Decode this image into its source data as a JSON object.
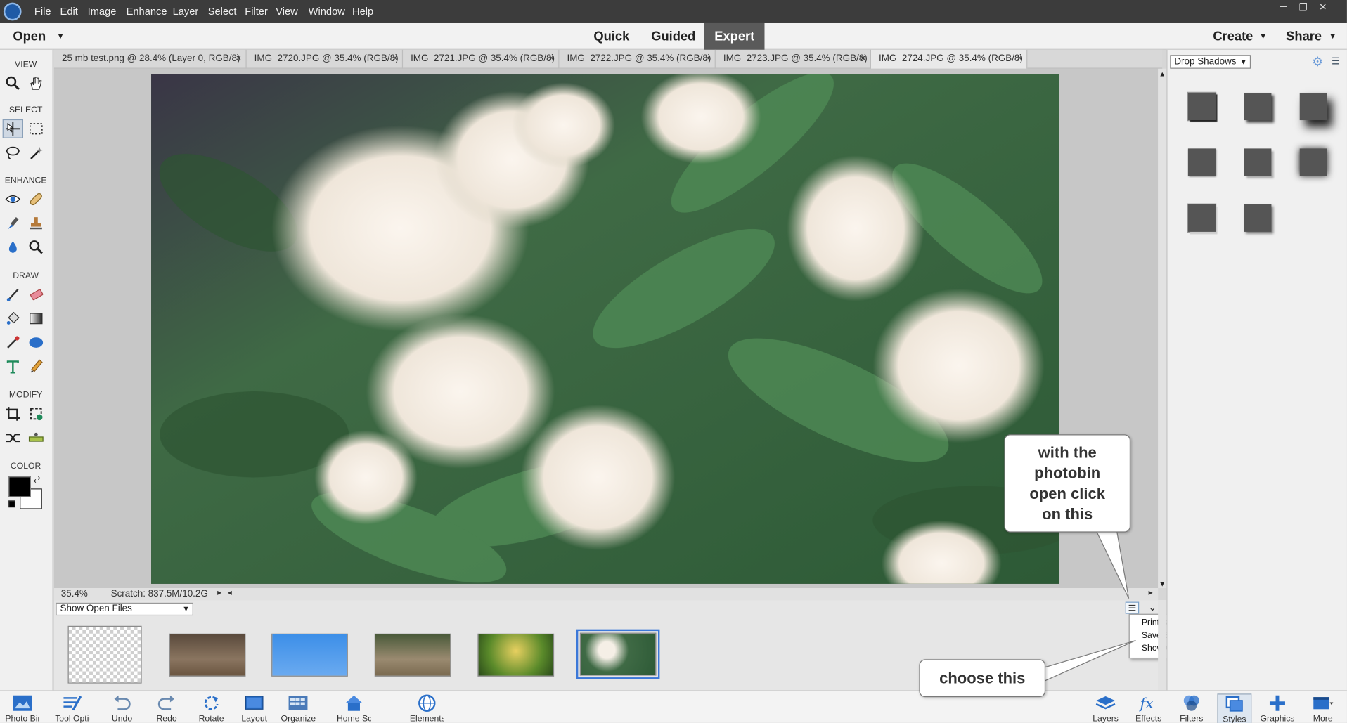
{
  "menu": {
    "items": [
      "File",
      "Edit",
      "Image",
      "Enhance",
      "Layer",
      "Select",
      "Filter",
      "View",
      "Window",
      "Help"
    ]
  },
  "topbar": {
    "open_label": "Open",
    "modes": [
      {
        "label": "Quick",
        "active": false
      },
      {
        "label": "Guided",
        "active": false
      },
      {
        "label": "Expert",
        "active": true
      }
    ],
    "create_label": "Create",
    "share_label": "Share"
  },
  "toolbox": {
    "sections": [
      "VIEW",
      "SELECT",
      "ENHANCE",
      "DRAW",
      "MODIFY",
      "COLOR"
    ],
    "foreground_color": "#000000",
    "background_color": "#ffffff"
  },
  "tabs": [
    {
      "label": "25 mb test.png @ 28.4% (Layer 0, RGB/8)",
      "close": "×",
      "active": false
    },
    {
      "label": "IMG_2720.JPG @ 35.4% (RGB/8)",
      "close": "×",
      "active": false
    },
    {
      "label": "IMG_2721.JPG @ 35.4% (RGB/8)",
      "close": "×",
      "active": false
    },
    {
      "label": "IMG_2722.JPG @ 35.4% (RGB/8)",
      "close": "×",
      "active": false
    },
    {
      "label": "IMG_2723.JPG @ 35.4% (RGB/8)",
      "close": "×",
      "active": false
    },
    {
      "label": "IMG_2724.JPG @ 35.4% (RGB/8)",
      "close": "×",
      "active": true
    }
  ],
  "status": {
    "zoom": "35.4%",
    "scratch": "Scratch: 837.5M/10.2G"
  },
  "photobin": {
    "select_value": "Show Open Files",
    "thumbnails": [
      {
        "name": "25 mb test.png",
        "selected": false
      },
      {
        "name": "IMG_2720.JPG",
        "selected": false
      },
      {
        "name": "IMG_2721.JPG",
        "selected": false
      },
      {
        "name": "IMG_2722.JPG",
        "selected": false
      },
      {
        "name": "IMG_2723.JPG",
        "selected": false
      },
      {
        "name": "IMG_2724.JPG",
        "selected": true
      }
    ],
    "menu": [
      "Print Bin Files...",
      "Save Bin as an Album...",
      "Show Grid..."
    ]
  },
  "right_panel": {
    "style_dropdown": "Drop Shadows"
  },
  "bottom": {
    "left_buttons": [
      "Photo Bin",
      "Tool Options",
      "Undo",
      "Redo",
      "Rotate",
      "Layout",
      "Organizer",
      "Home Screen",
      "Elements Web"
    ],
    "right_buttons": [
      "Layers",
      "Effects",
      "Filters",
      "Styles",
      "Graphics",
      "More"
    ]
  },
  "callouts": {
    "top": "with the photobin open click on this",
    "bottom": "choose this"
  }
}
